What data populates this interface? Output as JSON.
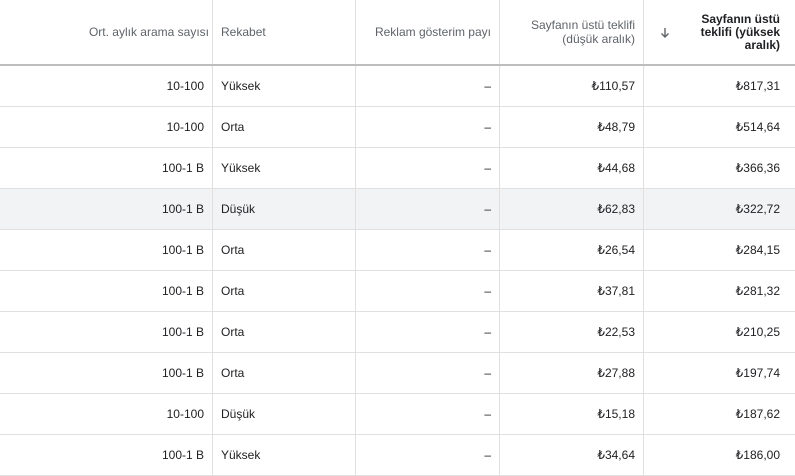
{
  "columns": {
    "searches": "Ort. aylık arama sayısı",
    "competition": "Rekabet",
    "impression_share": "Reklam gösterim payı",
    "bid_low": "Sayfanın üstü teklifi (düşük aralık)",
    "bid_high": "Sayfanın üstü teklifi (yüksek aralık)"
  },
  "sort_icon": "arrow-down-icon",
  "rows": [
    {
      "searches": "10-100",
      "competition": "Yüksek",
      "impression_share": "–",
      "bid_low": "₺110,57",
      "bid_high": "₺817,31"
    },
    {
      "searches": "10-100",
      "competition": "Orta",
      "impression_share": "–",
      "bid_low": "₺48,79",
      "bid_high": "₺514,64"
    },
    {
      "searches": "100-1 B",
      "competition": "Yüksek",
      "impression_share": "–",
      "bid_low": "₺44,68",
      "bid_high": "₺366,36"
    },
    {
      "searches": "100-1 B",
      "competition": "Düşük",
      "impression_share": "–",
      "bid_low": "₺62,83",
      "bid_high": "₺322,72"
    },
    {
      "searches": "100-1 B",
      "competition": "Orta",
      "impression_share": "–",
      "bid_low": "₺26,54",
      "bid_high": "₺284,15"
    },
    {
      "searches": "100-1 B",
      "competition": "Orta",
      "impression_share": "–",
      "bid_low": "₺37,81",
      "bid_high": "₺281,32"
    },
    {
      "searches": "100-1 B",
      "competition": "Orta",
      "impression_share": "–",
      "bid_low": "₺22,53",
      "bid_high": "₺210,25"
    },
    {
      "searches": "100-1 B",
      "competition": "Orta",
      "impression_share": "–",
      "bid_low": "₺27,88",
      "bid_high": "₺197,74"
    },
    {
      "searches": "10-100",
      "competition": "Düşük",
      "impression_share": "–",
      "bid_low": "₺15,18",
      "bid_high": "₺187,62"
    },
    {
      "searches": "100-1 B",
      "competition": "Yüksek",
      "impression_share": "–",
      "bid_low": "₺34,64",
      "bid_high": "₺186,00"
    }
  ]
}
